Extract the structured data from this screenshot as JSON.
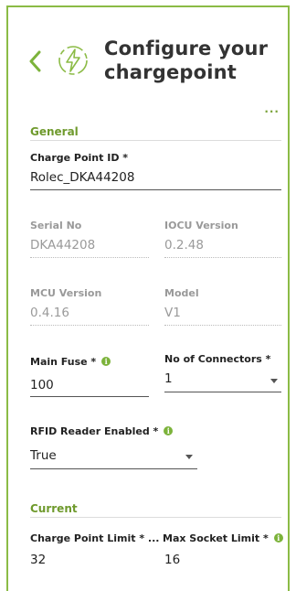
{
  "header": {
    "title": "Configure your chargepoint",
    "more_label": "..."
  },
  "general": {
    "heading": "General",
    "charge_point_id": {
      "label": "Charge Point ID *",
      "value": "Rolec_DKA44208"
    },
    "serial_no": {
      "label": "Serial No",
      "value": "DKA44208"
    },
    "iocu_version": {
      "label": "IOCU Version",
      "value": "0.2.48"
    },
    "mcu_version": {
      "label": "MCU Version",
      "value": "0.4.16"
    },
    "model": {
      "label": "Model",
      "value": "V1"
    },
    "main_fuse": {
      "label": "Main Fuse *",
      "value": "100"
    },
    "no_of_connectors": {
      "label": "No of Connectors *",
      "value": "1"
    },
    "rfid_reader_enabled": {
      "label": "RFID Reader Enabled *",
      "value": "True"
    }
  },
  "current": {
    "heading": "Current",
    "charge_point_limit": {
      "label": "Charge Point Limit * ...",
      "value": "32"
    },
    "max_socket_limit": {
      "label": "Max Socket Limit *",
      "value": "16"
    }
  },
  "colors": {
    "accent": "#7cb33b",
    "border": "#8bbb45"
  },
  "icons": {
    "back": "chevron-left-icon",
    "logo": "lightning-bolt-icon",
    "info": "info-icon"
  }
}
